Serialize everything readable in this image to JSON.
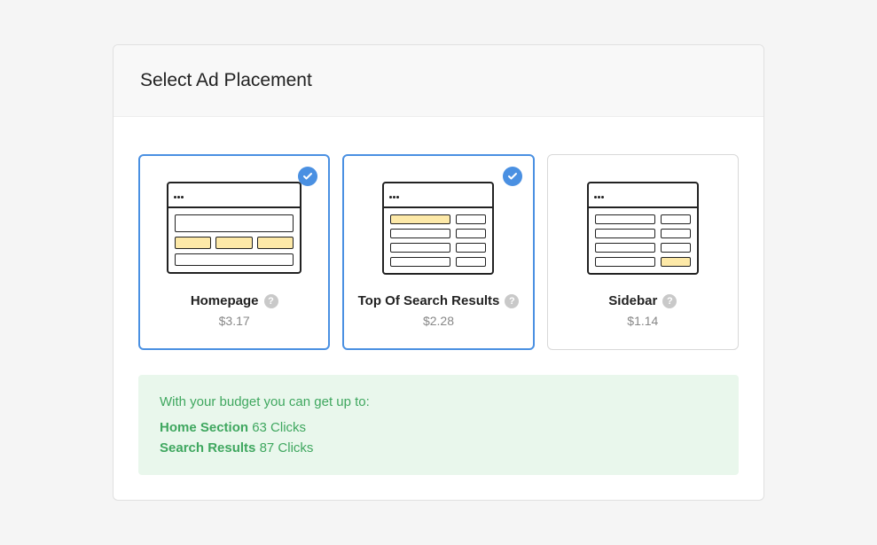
{
  "header": {
    "title": "Select Ad Placement"
  },
  "cards": [
    {
      "title": "Homepage",
      "price": "$3.17",
      "selected": true
    },
    {
      "title": "Top Of Search Results",
      "price": "$2.28",
      "selected": true
    },
    {
      "title": "Sidebar",
      "price": "$1.14",
      "selected": false
    }
  ],
  "budget": {
    "heading": "With your budget you can get up to:",
    "lines": [
      {
        "section": "Home Section",
        "clicks": "63 Clicks"
      },
      {
        "section": "Search Results",
        "clicks": "87 Clicks"
      }
    ]
  },
  "icons": {
    "help_label": "?"
  }
}
